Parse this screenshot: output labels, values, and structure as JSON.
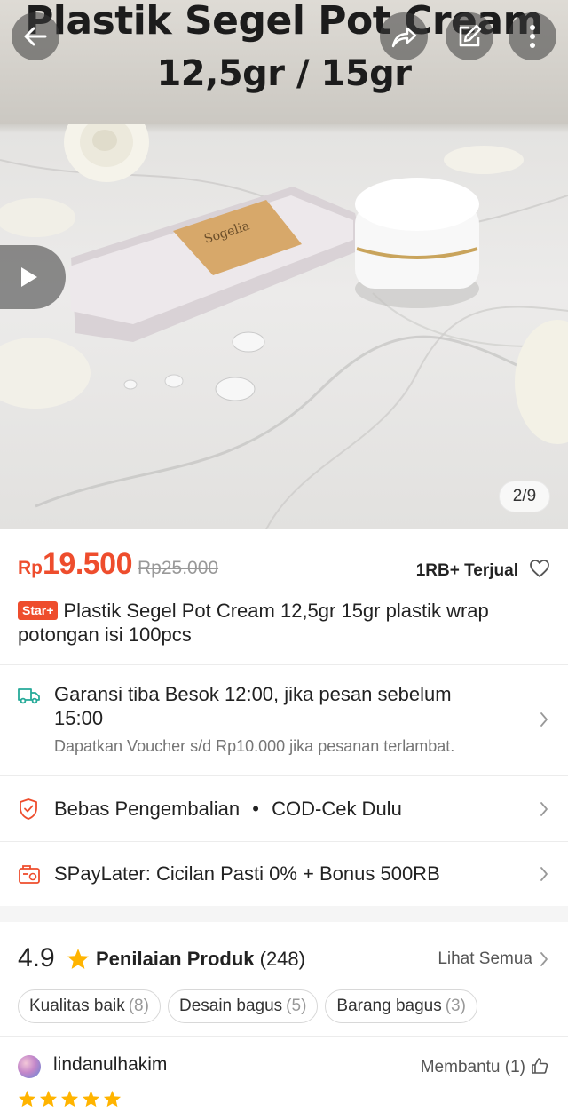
{
  "hero": {
    "title_line1": "Plastik Segel Pot Cream",
    "title_line2": "12,5gr / 15gr",
    "image_counter": "2/9",
    "icons": {
      "back": "arrow-left-icon",
      "share": "share-icon",
      "edit": "edit-icon",
      "more": "more-vertical-icon",
      "play": "play-icon"
    }
  },
  "product": {
    "currency": "Rp",
    "price": "19.500",
    "original_price": "Rp25.000",
    "sold": "1RB+ Terjual",
    "badge": "Star+",
    "title": "Plastik Segel Pot Cream 12,5gr 15gr plastik wrap potongan isi 100pcs"
  },
  "shipping": {
    "title": "Garansi tiba Besok 12:00, jika pesan sebelum 15:00",
    "subtitle": "Dapatkan Voucher s/d Rp10.000 jika pesanan terlambat.",
    "icon": "truck-icon"
  },
  "returns": {
    "text1": "Bebas Pengembalian",
    "separator": "•",
    "text2": "COD-Cek Dulu",
    "icon": "shield-check-icon"
  },
  "paylater": {
    "text": "SPayLater: Cicilan Pasti 0% + Bonus 500RB",
    "icon": "paylater-icon"
  },
  "ratings": {
    "score": "4.9",
    "label": "Penilaian Produk",
    "count": "(248)",
    "see_all": "Lihat Semua",
    "tags": [
      {
        "label": "Kualitas baik",
        "count": "(8)"
      },
      {
        "label": "Desain bagus",
        "count": "(5)"
      },
      {
        "label": "Barang bagus",
        "count": "(3)"
      }
    ]
  },
  "review": {
    "username": "lindanulhakim",
    "helpful": "Membantu (1)",
    "stars": 5
  },
  "colors": {
    "accent": "#ee4d2d",
    "star": "#ffb400"
  }
}
